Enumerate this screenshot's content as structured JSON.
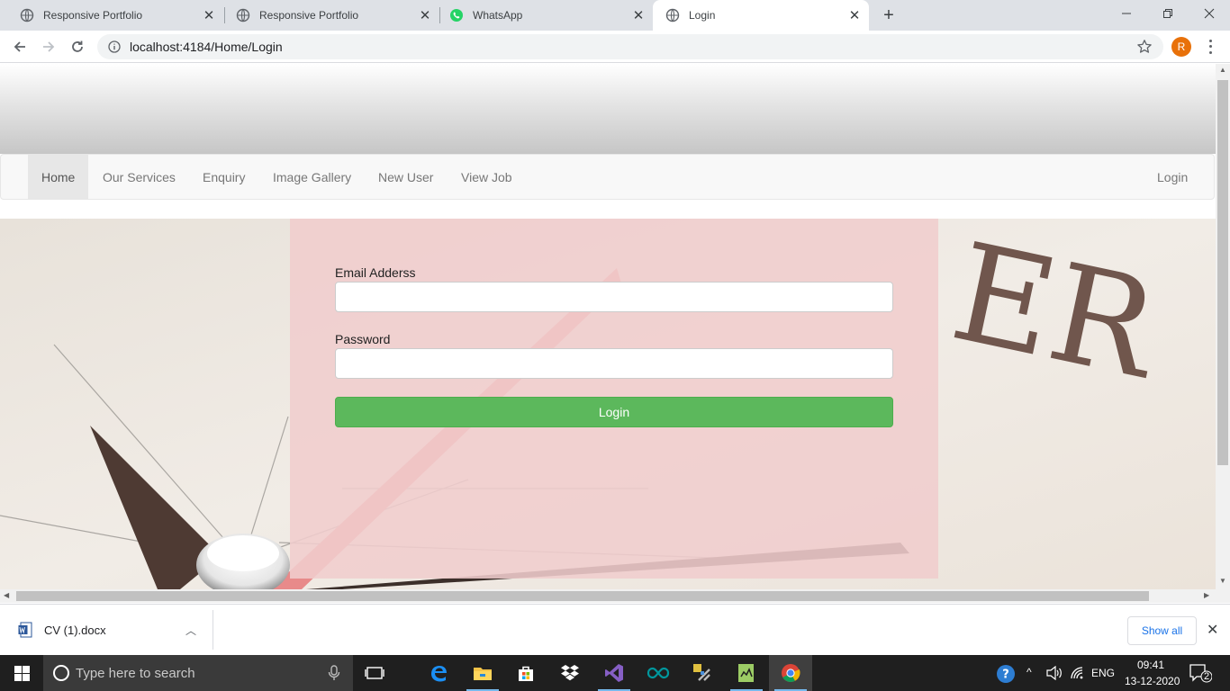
{
  "browser": {
    "tabs": [
      {
        "title": "Responsive Portfolio",
        "icon": "globe-icon",
        "active": false
      },
      {
        "title": "Responsive Portfolio",
        "icon": "globe-icon",
        "active": false
      },
      {
        "title": "WhatsApp",
        "icon": "whatsapp-icon",
        "active": false
      },
      {
        "title": "Login",
        "icon": "globe-icon",
        "active": true
      }
    ],
    "url": "localhost:4184/Home/Login",
    "profile_initial": "R"
  },
  "site": {
    "nav": {
      "items": [
        "Home",
        "Our Services",
        "Enquiry",
        "Image Gallery",
        "New User",
        "View Job"
      ],
      "active_item": "Home",
      "right_item": "Login"
    },
    "login_form": {
      "email_label": "Email Adderss",
      "email_value": "",
      "password_label": "Password",
      "password_value": "",
      "submit_label": "Login"
    },
    "background_letters": "ER"
  },
  "downloads": {
    "file_name": "CV (1).docx",
    "show_all_label": "Show all"
  },
  "taskbar": {
    "search_placeholder": "Type here to search",
    "language": "ENG",
    "time": "09:41",
    "date": "13-12-2020",
    "notification_count": "2"
  },
  "colors": {
    "login_button": "#5cb85c",
    "panel_overlay": "#f0cdcd",
    "profile_avatar": "#e8710a"
  }
}
